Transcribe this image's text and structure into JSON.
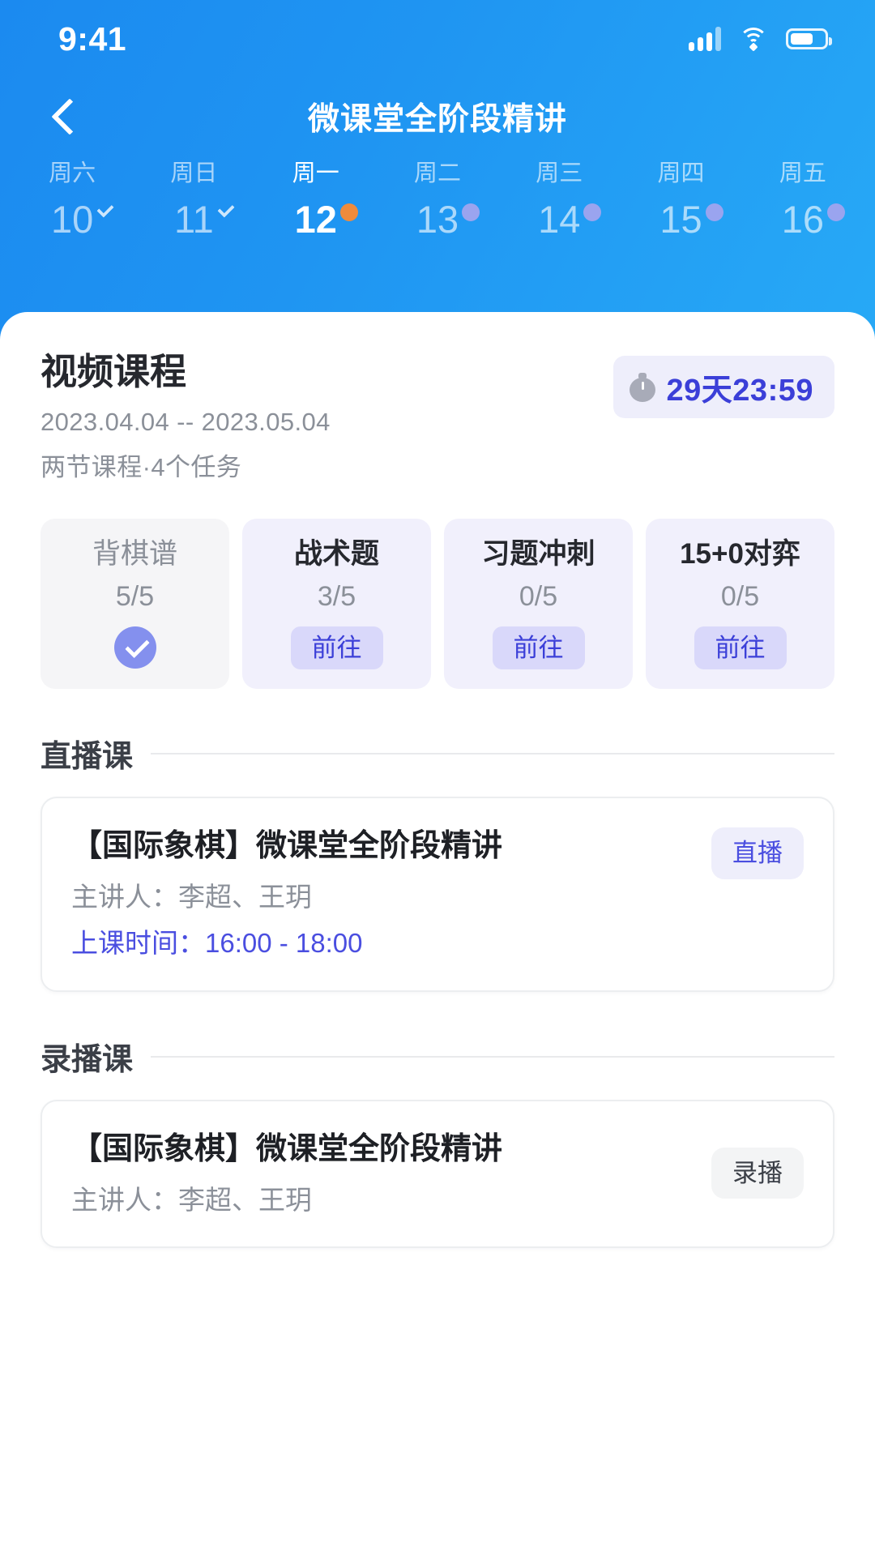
{
  "statusbar": {
    "time": "9:41",
    "signal_icon": "cellular-signal-icon",
    "wifi_icon": "wifi-icon",
    "battery_icon": "battery-icon"
  },
  "nav": {
    "back_icon": "chevron-left-icon",
    "title": "微课堂全阶段精讲"
  },
  "week": {
    "days": [
      {
        "name": "周六",
        "num": "10",
        "mark": "check",
        "active": false
      },
      {
        "name": "周日",
        "num": "11",
        "mark": "check",
        "active": false
      },
      {
        "name": "周一",
        "num": "12",
        "mark": "dot",
        "active": true,
        "dot_color": "#ef8b3c"
      },
      {
        "name": "周二",
        "num": "13",
        "mark": "dot",
        "active": false,
        "dot_color": "#9aa4ef"
      },
      {
        "name": "周三",
        "num": "14",
        "mark": "dot",
        "active": false,
        "dot_color": "#9aa4ef"
      },
      {
        "name": "周四",
        "num": "15",
        "mark": "dot",
        "active": false,
        "dot_color": "#9aa4ef"
      },
      {
        "name": "周五",
        "num": "16",
        "mark": "dot",
        "active": false,
        "dot_color": "#9aa4ef"
      }
    ]
  },
  "course": {
    "title": "视频课程",
    "date_range": "2023.04.04 -- 2023.05.04",
    "meta": "两节课程·4个任务",
    "countdown": "29天23:59",
    "countdown_icon": "stopwatch-icon"
  },
  "tasks": [
    {
      "name": "背棋谱",
      "progress": "5/5",
      "state": "done",
      "action": "",
      "check_icon": "check-circle-icon"
    },
    {
      "name": "战术题",
      "progress": "3/5",
      "state": "todo",
      "action": "前往"
    },
    {
      "name": "习题冲刺",
      "progress": "0/5",
      "state": "todo",
      "action": "前往"
    },
    {
      "name": "15+0对弈",
      "progress": "0/5",
      "state": "todo",
      "action": "前往"
    }
  ],
  "sections": [
    {
      "title": "直播课",
      "card": {
        "title": "【国际象棋】微课堂全阶段精讲",
        "teacher": "主讲人：李超、王玥",
        "time": "上课时间：16:00 - 18:00",
        "badge": "直播"
      }
    },
    {
      "title": "录播课",
      "card": {
        "title": "【国际象棋】微课堂全阶段精讲",
        "teacher": "主讲人：李超、王玥",
        "badge": "录播"
      }
    }
  ],
  "colors": {
    "header_blue_start": "#1b8af0",
    "header_blue_end": "#27a9f6",
    "accent_purple": "#3b3fd8",
    "tile_todo_bg": "#f1f0fc",
    "tile_done_bg": "#f5f5f7",
    "active_dot": "#ef8b3c",
    "pending_dot": "#9aa4ef",
    "check_circle": "#8490ee"
  }
}
